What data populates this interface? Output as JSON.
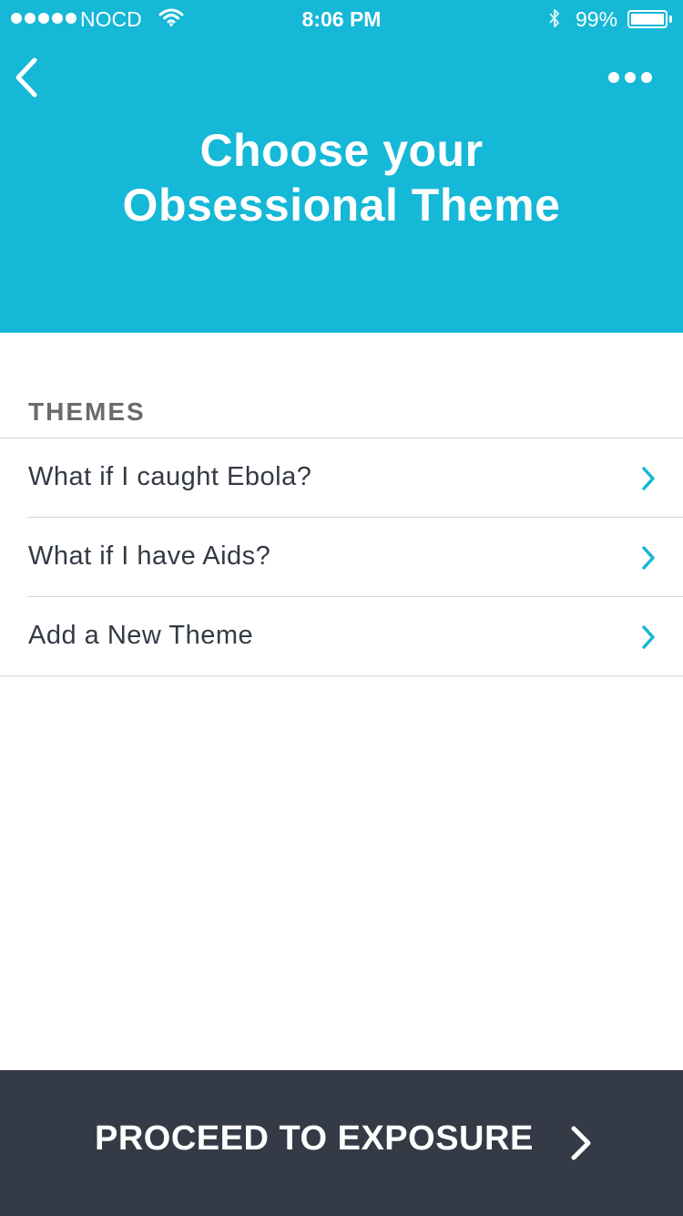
{
  "status_bar": {
    "carrier": "NOCD",
    "time": "8:06 PM",
    "battery_percent_text": "99%",
    "battery_level": 0.99,
    "signal_bars": 5,
    "icons": [
      "signal-dots-icon",
      "wifi-icon",
      "bluetooth-icon",
      "battery-icon"
    ]
  },
  "header": {
    "back_icon": "chevron-left-icon",
    "more_icon": "more-dots-icon",
    "title_line1": "Choose your",
    "title_line2": "Obsessional Theme",
    "background_color": "#15b8d6"
  },
  "themes": {
    "section_label": "THEMES",
    "items": [
      {
        "label": "What if I caught Ebola?"
      },
      {
        "label": "What if I have Aids?"
      },
      {
        "label": "Add a New Theme"
      }
    ],
    "chevron_color": "#15b8d6"
  },
  "footer": {
    "button_label": "PROCEED TO EXPOSURE",
    "arrow_icon": "chevron-right-icon",
    "background_color": "#343a46"
  }
}
